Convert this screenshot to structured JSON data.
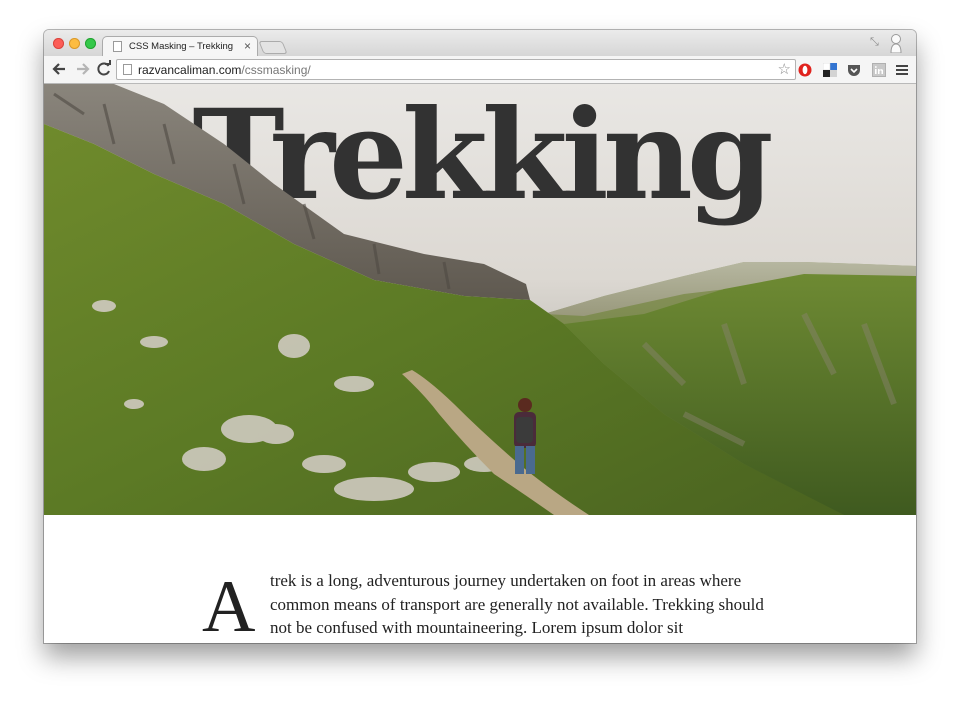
{
  "browser": {
    "tab_title": "CSS Masking – Trekking",
    "tab_close": "×",
    "url_host": "razvancaliman.com",
    "url_path": "/cssmasking/",
    "bookmark_star": "☆",
    "exit_fullscreen": "⤡",
    "icons": [
      "back-icon",
      "forward-icon",
      "reload-icon",
      "page-icon",
      "star-icon",
      "opera-icon",
      "delicious-icon",
      "pocket-icon",
      "linkedin-icon",
      "menu-icon",
      "profile-icon"
    ]
  },
  "page": {
    "hero_title": "Trekking",
    "dropcap": "A",
    "intro": "trek is a long, adventurous journey undertaken on foot in areas where common means of transport are generally not available. Trekking should not be confused with mountaineering. Lorem ipsum dolor sit"
  },
  "colors": {
    "title": "#323232",
    "grass": "#5f7a2a",
    "rock": "#8f8a80"
  }
}
